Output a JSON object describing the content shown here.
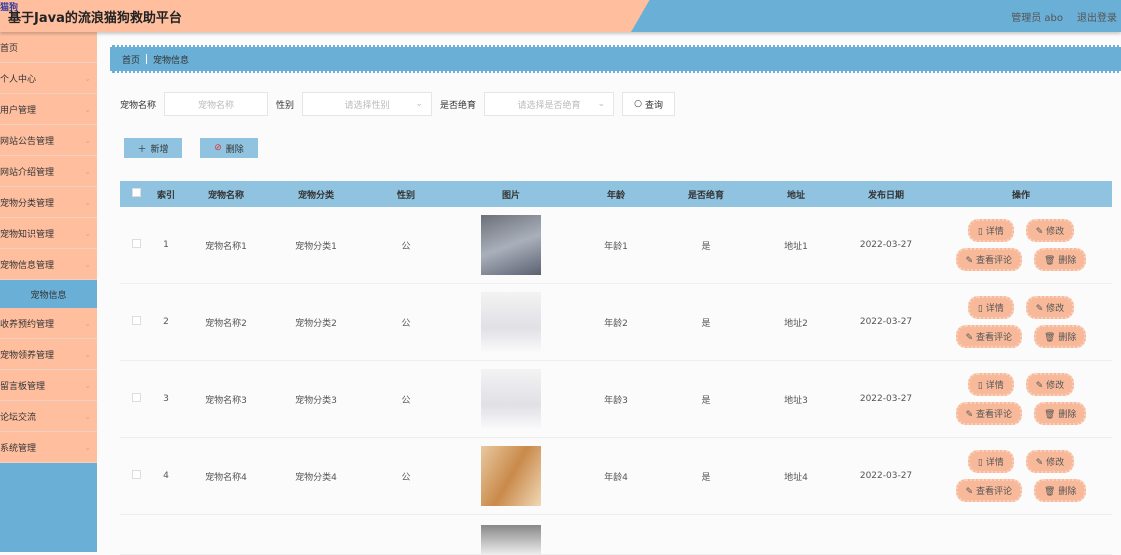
{
  "header": {
    "badge": "猫狗",
    "title": "基于Java的流浪猫狗救助平台",
    "user": "管理员 abo",
    "logout": "退出登录"
  },
  "sidebar": {
    "items": [
      {
        "label": "首页",
        "chevron": false
      },
      {
        "label": "个人中心",
        "chevron": true
      },
      {
        "label": "用户管理",
        "chevron": true
      },
      {
        "label": "网站公告管理",
        "chevron": true
      },
      {
        "label": "网站介绍管理",
        "chevron": true
      },
      {
        "label": "宠物分类管理",
        "chevron": true
      },
      {
        "label": "宠物知识管理",
        "chevron": true
      },
      {
        "label": "宠物信息管理",
        "chevron": true
      }
    ],
    "active_sub": "宠物信息",
    "items2": [
      {
        "label": "收养预约管理"
      },
      {
        "label": "宠物领养管理"
      },
      {
        "label": "留言板管理"
      },
      {
        "label": "论坛交流"
      },
      {
        "label": "系统管理"
      }
    ]
  },
  "breadcrumb": {
    "home": "首页",
    "current": "宠物信息"
  },
  "search": {
    "name_label": "宠物名称",
    "name_placeholder": "宠物名称",
    "gender_label": "性别",
    "gender_placeholder": "请选择性别",
    "sterile_label": "是否绝育",
    "sterile_placeholder": "请选择是否绝育",
    "query": "查询"
  },
  "actions": {
    "add": "新增",
    "delete": "删除"
  },
  "table": {
    "columns": [
      "索引",
      "宠物名称",
      "宠物分类",
      "性别",
      "图片",
      "年龄",
      "是否绝育",
      "地址",
      "发布日期",
      "操作"
    ],
    "rows": [
      {
        "index": "1",
        "name": "宠物名称1",
        "category": "宠物分类1",
        "gender": "公",
        "age": "年龄1",
        "sterile": "是",
        "address": "地址1",
        "date": "2022-03-27"
      },
      {
        "index": "2",
        "name": "宠物名称2",
        "category": "宠物分类2",
        "gender": "公",
        "age": "年龄2",
        "sterile": "是",
        "address": "地址2",
        "date": "2022-03-27"
      },
      {
        "index": "3",
        "name": "宠物名称3",
        "category": "宠物分类3",
        "gender": "公",
        "age": "年龄3",
        "sterile": "是",
        "address": "地址3",
        "date": "2022-03-27"
      },
      {
        "index": "4",
        "name": "宠物名称4",
        "category": "宠物分类4",
        "gender": "公",
        "age": "年龄4",
        "sterile": "是",
        "address": "地址4",
        "date": "2022-03-27"
      }
    ],
    "ops": {
      "detail": "详情",
      "edit": "修改",
      "comments": "查看评论",
      "delete": "删除"
    }
  },
  "colors": {
    "peach": "#ffbf9f",
    "blue": "#6aafd6",
    "header_blue": "#8fc3df"
  }
}
